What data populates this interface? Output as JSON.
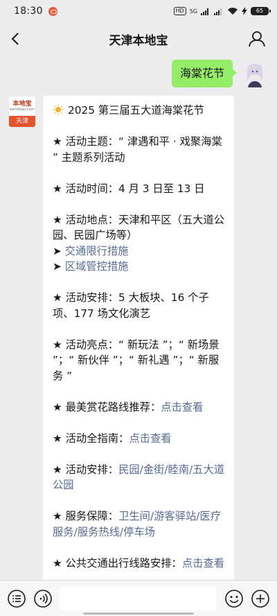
{
  "status_bar": {
    "time": "18:30",
    "network_badge": "HD",
    "signal_label": "5G",
    "battery": "65"
  },
  "nav": {
    "title": "天津本地宝"
  },
  "outgoing_message": {
    "text": "海棠花节"
  },
  "bot_avatar": {
    "logo_text": "本地宝",
    "logo_sub": "bendibao.com",
    "city": "天津"
  },
  "message": {
    "title": "2025 第三届五大道海棠花节",
    "theme": "★ 活动主题：“ 津遇和平 · 戏聚海棠 ” 主题系列活动",
    "time": "★ 活动时间：4 月 3 日至 13 日",
    "place": "★ 活动地点：天津和平区（五大道公园、民园广场等）",
    "traffic_prefix": "➤ ",
    "traffic_link": "交通限行措施",
    "area_prefix": "➤ ",
    "area_link": "区域管控措施",
    "arrangement": "★ 活动安排：5 大板块、16 个子项、177 场文化演艺",
    "highlights": "★ 活动亮点：“ 新玩法 ”；“ 新场景 ”；“ 新伙伴 ”；“ 新礼遇 ”；“ 新服务 ”",
    "route_prefix": "★ 最美赏花路线推荐：",
    "route_link": "点击查看",
    "guide_prefix": "★ 活动全指南：",
    "guide_link": "点击查看",
    "venues_prefix": "★ 活动安排：",
    "venues_link": "民园/金街/睦南/五大道公园",
    "service_prefix": "★ 服务保障：",
    "service_link": "卫生间/游客驿站/医疗服务/服务热线/停车场",
    "transit_prefix": "★ 公共交通出行线路安排：",
    "transit_link": "点击查看"
  },
  "icons": {
    "back": "chevron-left-icon",
    "profile": "person-icon",
    "menu": "list-circle-icon",
    "voice": "voice-icon",
    "emoji": "smiley-icon",
    "more": "plus-circle-icon",
    "sun": "sun-icon"
  },
  "colors": {
    "bubble_out": "#95ec69",
    "link": "#576b95",
    "background": "#ededed",
    "brand": "#e4532c"
  }
}
